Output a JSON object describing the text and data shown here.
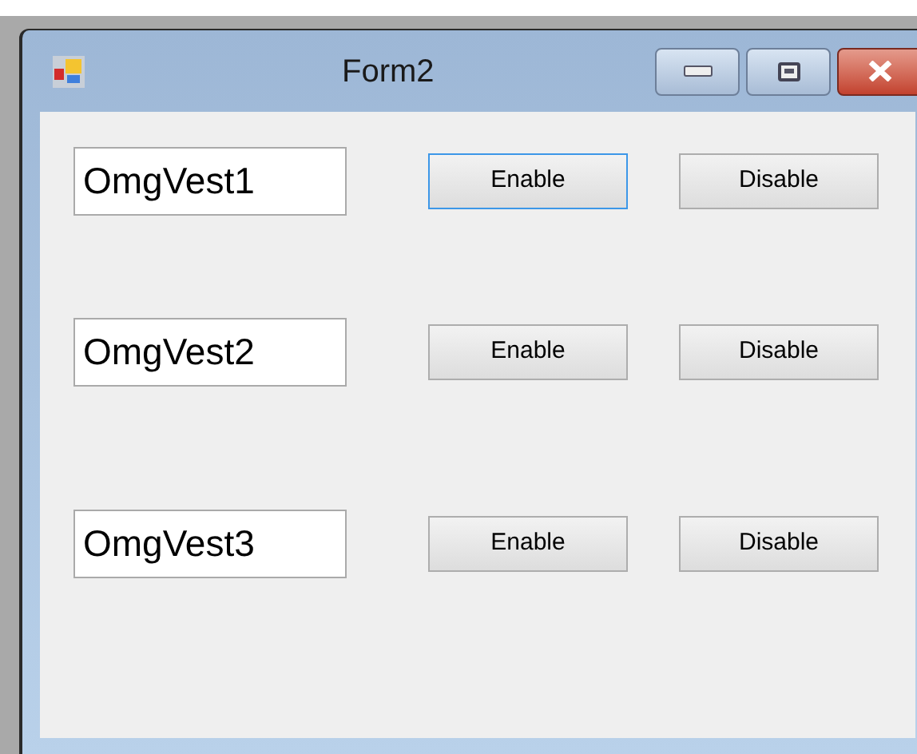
{
  "window": {
    "title": "Form2"
  },
  "rows": [
    {
      "text": "OmgVest1",
      "enable": {
        "label": "Enable",
        "focused": true
      },
      "disable": {
        "label": "Disable",
        "focused": false
      }
    },
    {
      "text": "OmgVest2",
      "enable": {
        "label": "Enable",
        "focused": false
      },
      "disable": {
        "label": "Disable",
        "focused": false
      }
    },
    {
      "text": "OmgVest3",
      "enable": {
        "label": "Enable",
        "focused": false
      },
      "disable": {
        "label": "Disable",
        "focused": false
      }
    }
  ]
}
